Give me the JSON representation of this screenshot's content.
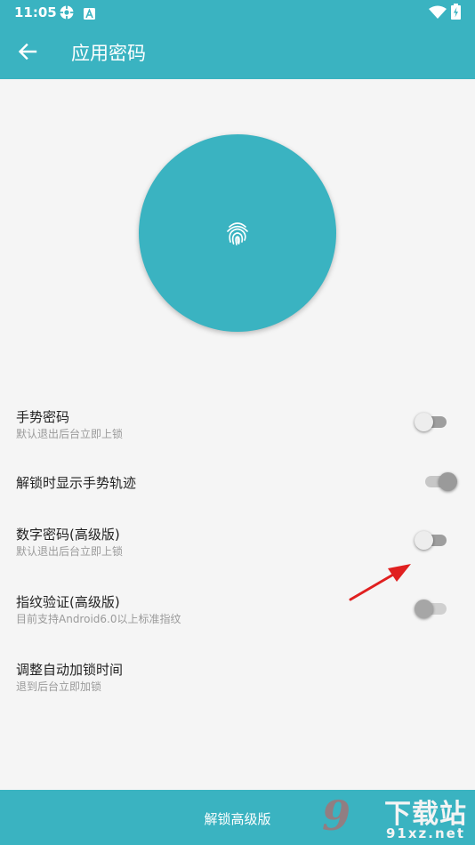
{
  "status_bar": {
    "time": "11:05"
  },
  "app_bar": {
    "title": "应用密码"
  },
  "settings": [
    {
      "title": "手势密码",
      "subtitle": "默认退出后台立即上锁",
      "enabled": false
    },
    {
      "title": "解锁时显示手势轨迹",
      "enabled": true
    },
    {
      "title": "数字密码(高级版)",
      "subtitle": "默认退出后台立即上锁",
      "enabled": false
    },
    {
      "title": "指纹验证(高级版)",
      "subtitle": "目前支持Android6.0以上标准指纹",
      "enabled": false
    },
    {
      "title": "调整自动加锁时间",
      "subtitle": "退到后台立即加锁"
    }
  ],
  "bottom_button": {
    "label": "解锁高级版"
  },
  "watermark": {
    "number": "9",
    "text": "下载站",
    "url": "91xz.net"
  },
  "colors": {
    "primary": "#3ab3c1",
    "background": "#f5f5f5",
    "annotation_arrow": "#e02020"
  },
  "icons": {
    "back": "arrow-left-icon",
    "fingerprint": "fingerprint-icon",
    "status": [
      "settings-status-icon",
      "a-status-icon",
      "wifi-icon",
      "battery-charging-icon"
    ]
  }
}
